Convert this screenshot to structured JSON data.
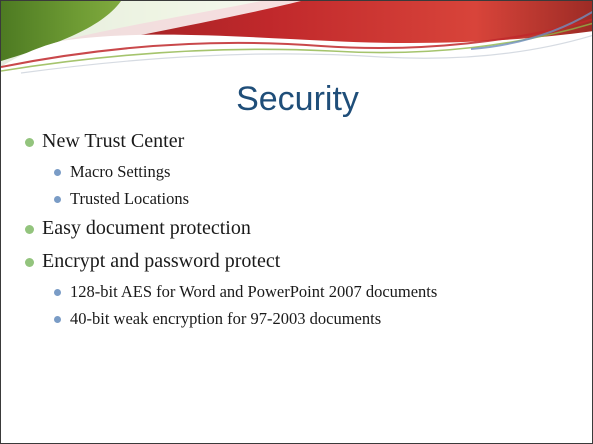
{
  "slide": {
    "title": "Security",
    "bullets": [
      {
        "level": 1,
        "text": "New Trust Center"
      },
      {
        "level": 2,
        "text": "Macro Settings"
      },
      {
        "level": 2,
        "text": "Trusted Locations"
      },
      {
        "level": 1,
        "text": "Easy document protection"
      },
      {
        "level": 1,
        "text": "Encrypt and password protect"
      },
      {
        "level": 2,
        "text": "128-bit AES for Word and PowerPoint 2007 documents"
      },
      {
        "level": 2,
        "text": "40-bit weak encryption for 97-2003 documents"
      }
    ]
  },
  "theme": {
    "title_color": "#1f4e79",
    "level1_bullet_color": "#93c47d",
    "level2_bullet_color": "#7a9cc6",
    "header_red": "#c0282b",
    "header_green": "#5e8c2f"
  }
}
